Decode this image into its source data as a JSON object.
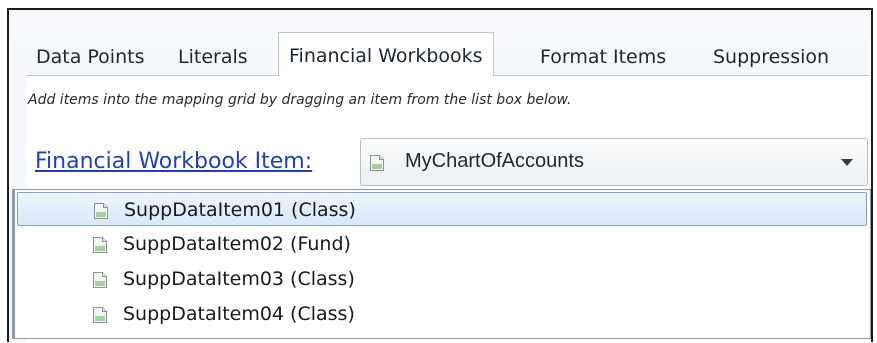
{
  "tabs": [
    {
      "label": "Data Points",
      "active": false
    },
    {
      "label": "Literals",
      "active": false
    },
    {
      "label": "Financial Workbooks",
      "active": true
    },
    {
      "label": "Format Items",
      "active": false
    },
    {
      "label": "Suppression",
      "active": false
    }
  ],
  "hint": "Add items into the mapping grid by dragging an item from the list box below.",
  "workbook_item": {
    "label": "Financial Workbook Item:",
    "selected_value": "MyChartOfAccounts",
    "icon": "document-icon",
    "dropdown_icon": "chevron-down-icon"
  },
  "list_items": [
    {
      "label": "SuppDataItem01 (Class)",
      "selected": true,
      "icon": "document-icon"
    },
    {
      "label": "SuppDataItem02 (Fund)",
      "selected": false,
      "icon": "document-icon"
    },
    {
      "label": "SuppDataItem03 (Class)",
      "selected": false,
      "icon": "document-icon"
    },
    {
      "label": "SuppDataItem04 (Class)",
      "selected": false,
      "icon": "document-icon"
    }
  ],
  "colors": {
    "link": "#1f3fbf",
    "selection": "#d9e8fa",
    "selection_border": "#7da2ce",
    "tab_border": "#b9c6d6"
  }
}
